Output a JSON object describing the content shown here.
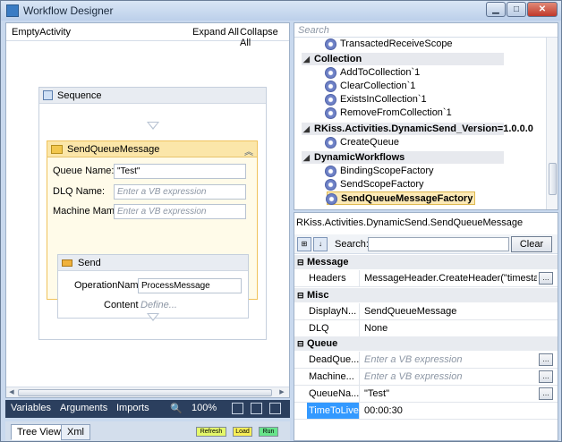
{
  "window": {
    "title": "Workflow Designer",
    "min": "▁",
    "max": "□",
    "close": "✕"
  },
  "designer": {
    "breadcrumb": "EmptyActivity",
    "expand_all": "Expand All",
    "collapse_all": "Collapse All",
    "sequence_title": "Sequence",
    "activity": {
      "title": "SendQueueMessage",
      "fields": [
        {
          "label": "Queue Name:",
          "value": "\"Test\""
        },
        {
          "label": "DLQ Name:",
          "value": "Enter a VB expression"
        },
        {
          "label": "Machine Mame:",
          "value": "Enter a VB expression"
        }
      ],
      "send": {
        "title": "Send",
        "operation_label": "OperationName",
        "operation_value": "ProcessMessage",
        "content_label": "Content",
        "content_value": "Define..."
      }
    }
  },
  "bottombar": {
    "variables": "Variables",
    "arguments": "Arguments",
    "imports": "Imports",
    "zoom": "100%"
  },
  "tabs": {
    "tree_view": "Tree View",
    "xml": "Xml",
    "refresh": "Refresh",
    "load": "Load",
    "run": "Run"
  },
  "toolbox": {
    "search_placeholder": "Search",
    "items": [
      {
        "text": "TransactedReceiveScope"
      },
      {
        "text": "Collection",
        "category": true
      },
      {
        "text": "AddToCollection`1"
      },
      {
        "text": "ClearCollection`1"
      },
      {
        "text": "ExistsInCollection`1"
      },
      {
        "text": "RemoveFromCollection`1"
      },
      {
        "text": "RKiss.Activities.DynamicSend_Version=1.0.0.0",
        "category": true
      },
      {
        "text": "CreateQueue"
      },
      {
        "text": "DynamicWorkflows",
        "category": true
      },
      {
        "text": "BindingScopeFactory"
      },
      {
        "text": "SendScopeFactory"
      },
      {
        "text": "SendQueueMessageFactory",
        "selected": true
      }
    ]
  },
  "properties": {
    "title": "RKiss.Activities.DynamicSend.SendQueueMessage",
    "search_label": "Search:",
    "clear": "Clear",
    "categories": [
      {
        "name": "Message",
        "rows": [
          {
            "name": "Headers",
            "value": "MessageHeader.CreateHeader(\"timestamp\"",
            "button": true
          }
        ]
      },
      {
        "name": "Misc",
        "rows": [
          {
            "name": "DisplayN...",
            "value": "SendQueueMessage"
          },
          {
            "name": "DLQ",
            "value": "None"
          }
        ]
      },
      {
        "name": "Queue",
        "rows": [
          {
            "name": "DeadQue...",
            "value": "Enter a VB expression",
            "button": true,
            "placeholder": true
          },
          {
            "name": "Machine...",
            "value": "Enter a VB expression",
            "button": true,
            "placeholder": true
          },
          {
            "name": "QueueNa...",
            "value": "\"Test\"",
            "button": true
          },
          {
            "name": "TimeToLive",
            "value": "00:00:30",
            "selected": true
          }
        ]
      }
    ]
  }
}
